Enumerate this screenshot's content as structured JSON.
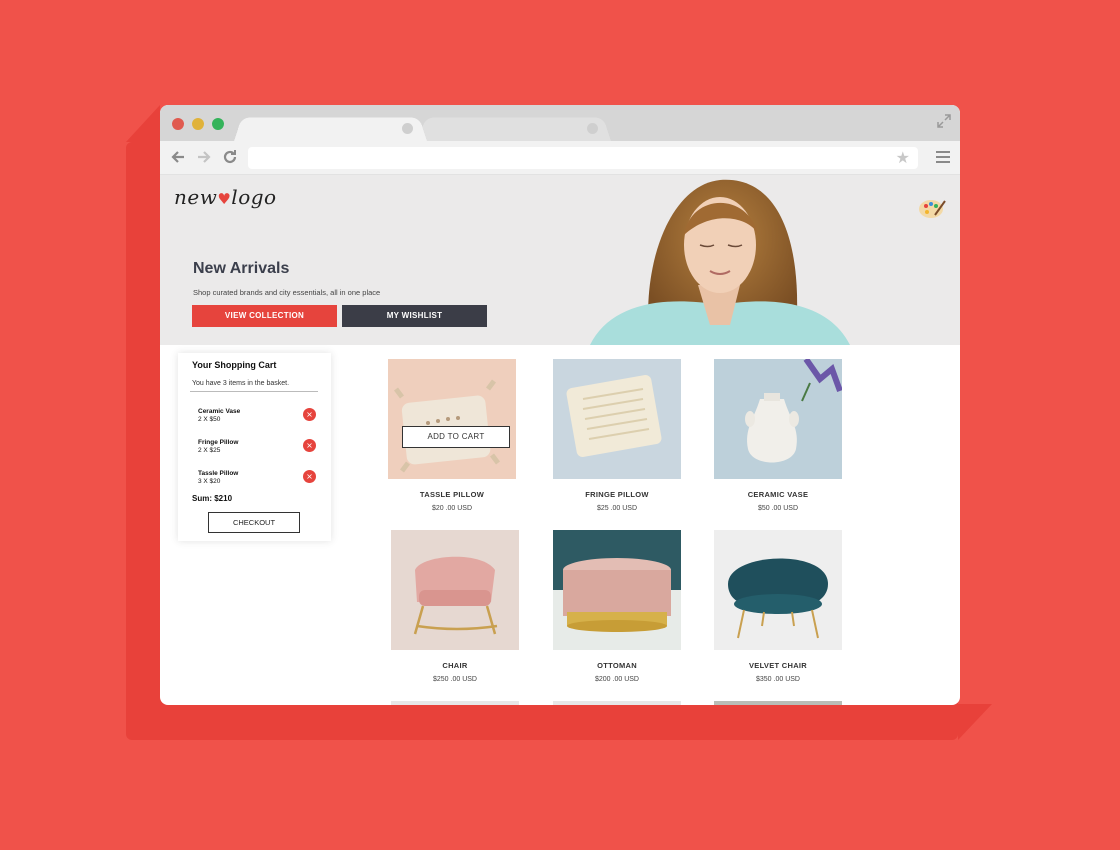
{
  "hero": {
    "logo_text": "new",
    "logo_text2": "logo",
    "title": "New Arrivals",
    "subtitle": "Shop curated brands and city essentials, all in one place",
    "primary_button": "VIEW COLLECTION",
    "secondary_button": "MY WISHLIST"
  },
  "cart": {
    "title": "Your Shopping Cart",
    "count_text": "You have 3 items in the basket.",
    "items": [
      {
        "name": "Ceramic Vase",
        "qty": "2 X $50"
      },
      {
        "name": "Fringe Pillow",
        "qty": "2 X $25"
      },
      {
        "name": "Tassle Pillow",
        "qty": "3 X $20"
      }
    ],
    "sum": "Sum: $210",
    "checkout_label": "CHECKOUT"
  },
  "products": [
    {
      "name": "TASSLE PILLOW",
      "price": "$20 .00 USD"
    },
    {
      "name": "FRINGE PILLOW",
      "price": "$25 .00 USD"
    },
    {
      "name": "CERAMIC VASE",
      "price": "$50 .00 USD"
    },
    {
      "name": "CHAIR",
      "price": "$250 .00 USD"
    },
    {
      "name": "OTTOMAN",
      "price": "$200 .00 USD"
    },
    {
      "name": "VELVET CHAIR",
      "price": "$350 .00 USD"
    }
  ],
  "add_to_cart_label": "ADD TO CART",
  "icons": {
    "back": "back-arrow-icon",
    "forward": "forward-arrow-icon",
    "reload": "reload-icon",
    "bookmark": "star-icon",
    "menu": "hamburger-menu-icon",
    "fullscreen": "expand-icon",
    "theme": "palette-icon",
    "remove": "close-icon"
  },
  "colors": {
    "background": "#f0524a",
    "accent": "#e6443d",
    "dark_button": "#3b3d47"
  }
}
